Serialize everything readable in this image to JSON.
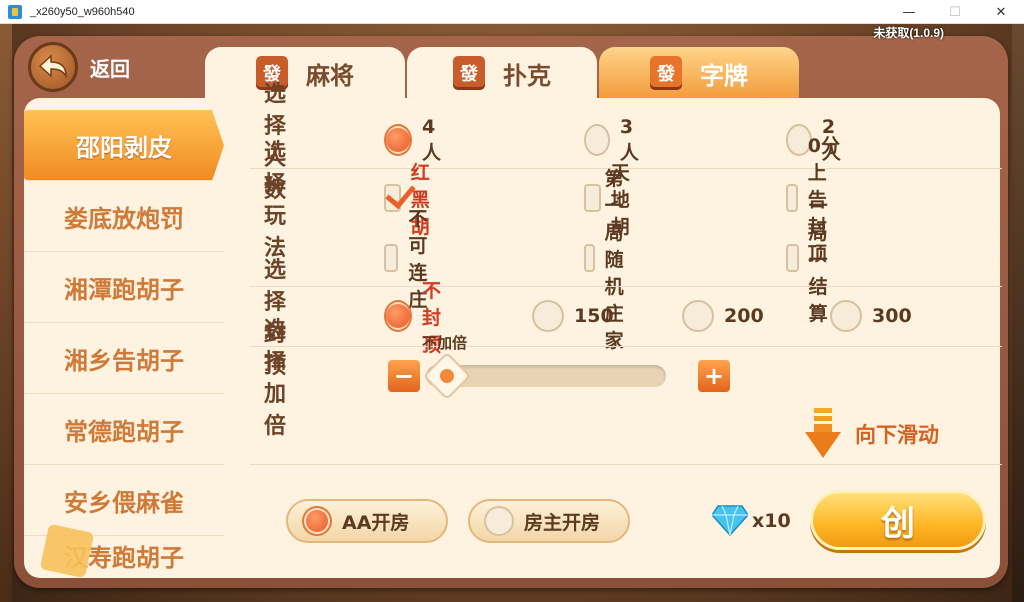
{
  "window": {
    "title": "_x260y50_w960h540",
    "minimize": "—",
    "maximize": "☐",
    "close": "✕"
  },
  "version": "未获取(1.0.9)",
  "back": {
    "label": "返回",
    "icon": "back-arrow-icon"
  },
  "tabs": [
    {
      "label": "麻将",
      "tile": "發",
      "active": false
    },
    {
      "label": "扑克",
      "tile": "發",
      "active": false
    },
    {
      "label": "字牌",
      "tile": "發",
      "active": true
    }
  ],
  "games": [
    {
      "label": "邵阳剥皮",
      "active": true
    },
    {
      "label": "娄底放炮罚",
      "active": false
    },
    {
      "label": "湘潭跑胡子",
      "active": false
    },
    {
      "label": "湘乡告胡子",
      "active": false
    },
    {
      "label": "常德跑胡子",
      "active": false
    },
    {
      "label": "安乡偎麻雀",
      "active": false
    },
    {
      "label": "汉寿跑胡子",
      "active": false
    }
  ],
  "players": {
    "label": "选择人数",
    "options": [
      {
        "label": "4人",
        "selected": true
      },
      {
        "label": "3人",
        "selected": false
      },
      {
        "label": "2人",
        "selected": false
      }
    ]
  },
  "rules": {
    "label": "选择玩法",
    "options": [
      {
        "label": "红黑胡",
        "checked": true
      },
      {
        "label": "天地胡",
        "checked": false
      },
      {
        "label": "0分上告封顶",
        "checked": false
      },
      {
        "label": "不可连庄",
        "checked": false
      },
      {
        "label": "第一局随机庄家",
        "checked": false
      },
      {
        "label": "一局一结算",
        "checked": false
      }
    ]
  },
  "cap": {
    "label": "选择封顶",
    "options": [
      {
        "label": "不封顶",
        "selected": true
      },
      {
        "label": "150",
        "selected": false
      },
      {
        "label": "200",
        "selected": false
      },
      {
        "label": "300",
        "selected": false
      }
    ]
  },
  "multiplier": {
    "label": "选择加倍",
    "value_label": "不加倍",
    "minus": "−",
    "plus": "+",
    "level": 0
  },
  "scroll_hint": "向下滑动",
  "room": {
    "options": [
      {
        "label": "AA开房",
        "selected": true
      },
      {
        "label": "房主开房",
        "selected": false
      }
    ],
    "cost": "x10",
    "create_label": "创"
  },
  "colors": {
    "accent": "#f08b22",
    "panel": "#a5654a",
    "content_bg": "#fdf3e0",
    "text_brown": "#6b4329"
  }
}
